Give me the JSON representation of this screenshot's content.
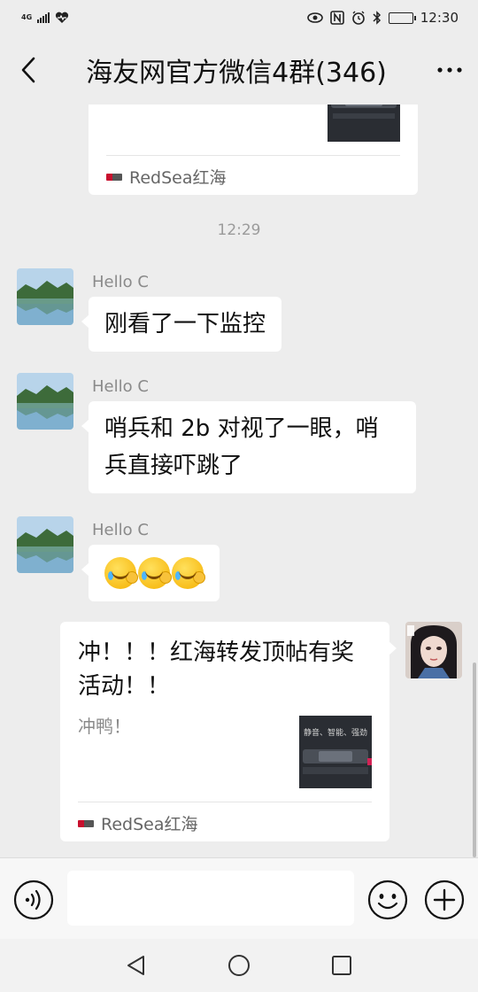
{
  "status_bar": {
    "network": "4G",
    "time": "12:30",
    "battery_level": 0.5
  },
  "header": {
    "title": "海友网官方微信4群(346)",
    "back_icon": "chevron-left-icon",
    "more_label": "···"
  },
  "chat": {
    "top_card": {
      "source": "RedSea红海"
    },
    "timestamp": "12:29",
    "messages": [
      {
        "sender": "Hello C",
        "text": "刚看了一下监控"
      },
      {
        "sender": "Hello C",
        "text": "哨兵和 2b 对视了一眼，哨兵直接吓跳了"
      },
      {
        "sender": "Hello C",
        "emoji": [
          "facepalm-emoji",
          "facepalm-emoji",
          "facepalm-emoji"
        ]
      }
    ],
    "self_card": {
      "title": "冲！！！红海转发顶帖有奖活动！！",
      "description": "冲鸭！",
      "thumb_caption": "静音、智能、强劲",
      "source": "RedSea红海"
    }
  },
  "input_bar": {
    "placeholder": "",
    "voice_icon": "voice-icon",
    "emoji_icon": "smiley-icon",
    "plus_icon": "plus-icon"
  },
  "nav_bar": {
    "back_icon": "triangle-back-icon",
    "home_icon": "circle-home-icon",
    "recent_icon": "square-recent-icon"
  }
}
